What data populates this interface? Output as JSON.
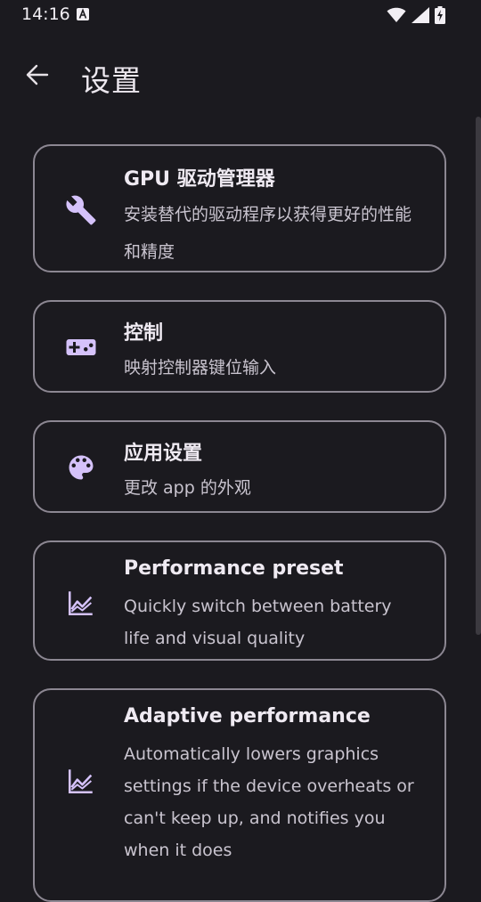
{
  "status_bar": {
    "time": "14:16"
  },
  "header": {
    "title": "设置",
    "back_icon": "arrow-back-icon"
  },
  "settings": [
    {
      "icon": "wrench-icon",
      "title": "GPU 驱动管理器",
      "description": "安装替代的驱动程序以获得更好的性能和精度"
    },
    {
      "icon": "gamepad-icon",
      "title": "控制",
      "description": "映射控制器键位输入"
    },
    {
      "icon": "palette-icon",
      "title": "应用设置",
      "description": "更改 app 的外观"
    },
    {
      "icon": "chart-line-icon",
      "title": "Performance preset",
      "description": "Quickly switch between battery life and visual quality"
    },
    {
      "icon": "chart-line-icon",
      "title": "Adaptive performance",
      "description": "Automatically lowers graphics settings if the device overheats or can't keep up, and notifies you when it does"
    }
  ],
  "colors": {
    "background": "#1b1a1f",
    "card_border": "#8c8792",
    "icon_accent": "#d5c2fa"
  }
}
